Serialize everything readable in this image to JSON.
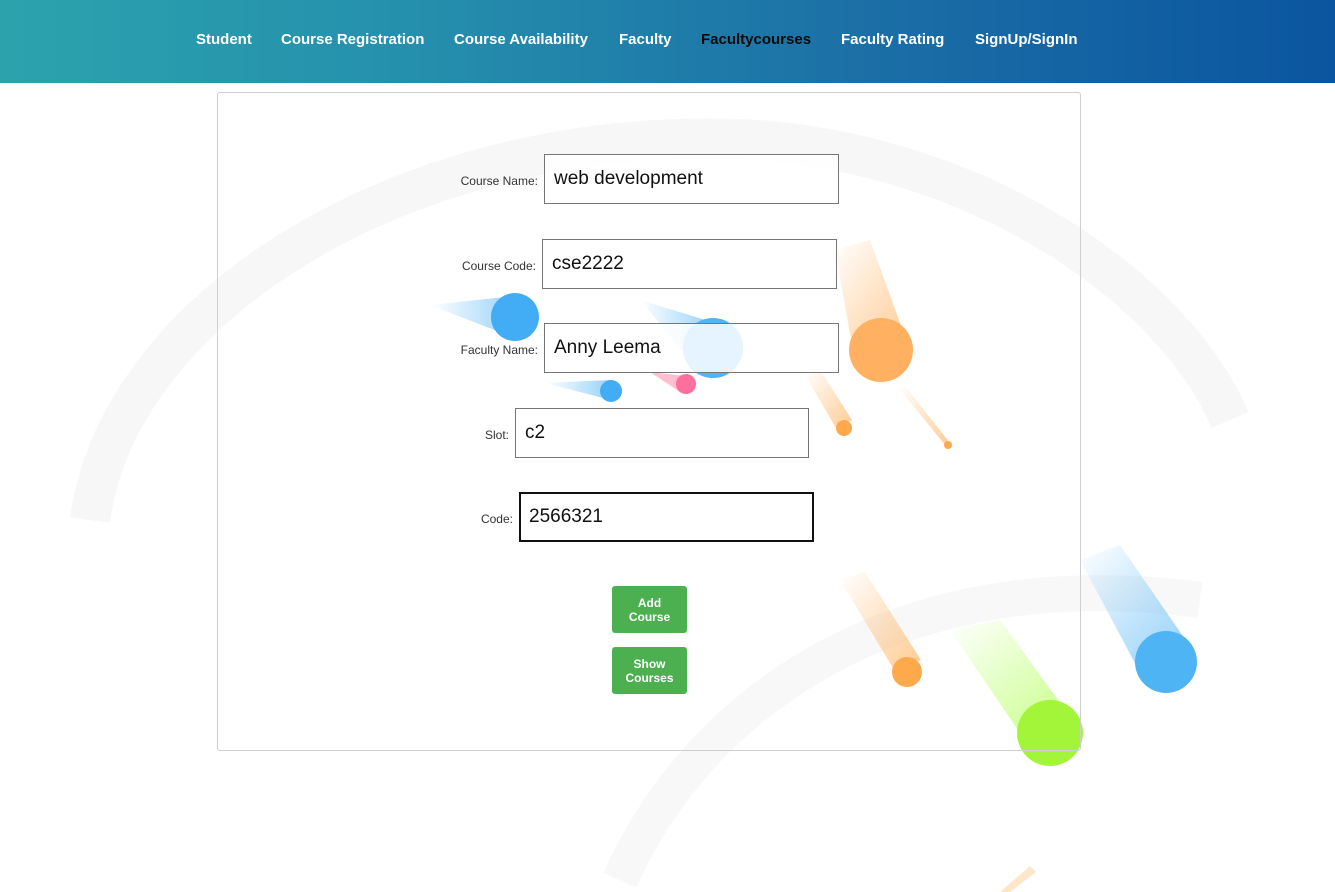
{
  "nav": {
    "items": [
      {
        "label": "Student"
      },
      {
        "label": "Course Registration"
      },
      {
        "label": "Course Availability"
      },
      {
        "label": "Faculty"
      },
      {
        "label": "Facultycourses"
      },
      {
        "label": "Faculty Rating"
      },
      {
        "label": "SignUp/SignIn"
      }
    ],
    "active": "Facultycourses"
  },
  "form": {
    "course_name": {
      "label": "Course Name:",
      "value": "web development"
    },
    "course_code": {
      "label": "Course Code:",
      "value": "cse2222"
    },
    "faculty_name": {
      "label": "Faculty Name:",
      "value": "Anny Leema"
    },
    "slot": {
      "label": "Slot:",
      "value": "c2"
    },
    "code": {
      "label": "Code:",
      "value": "2566321"
    }
  },
  "buttons": {
    "add_course": "Add Course",
    "show_courses": "Show Courses"
  },
  "colors": {
    "nav_gradient_start": "#2ba3ad",
    "nav_gradient_end": "#0b55a0",
    "button_green": "#4caf50",
    "active_nav_text": "#0a0a0a"
  }
}
